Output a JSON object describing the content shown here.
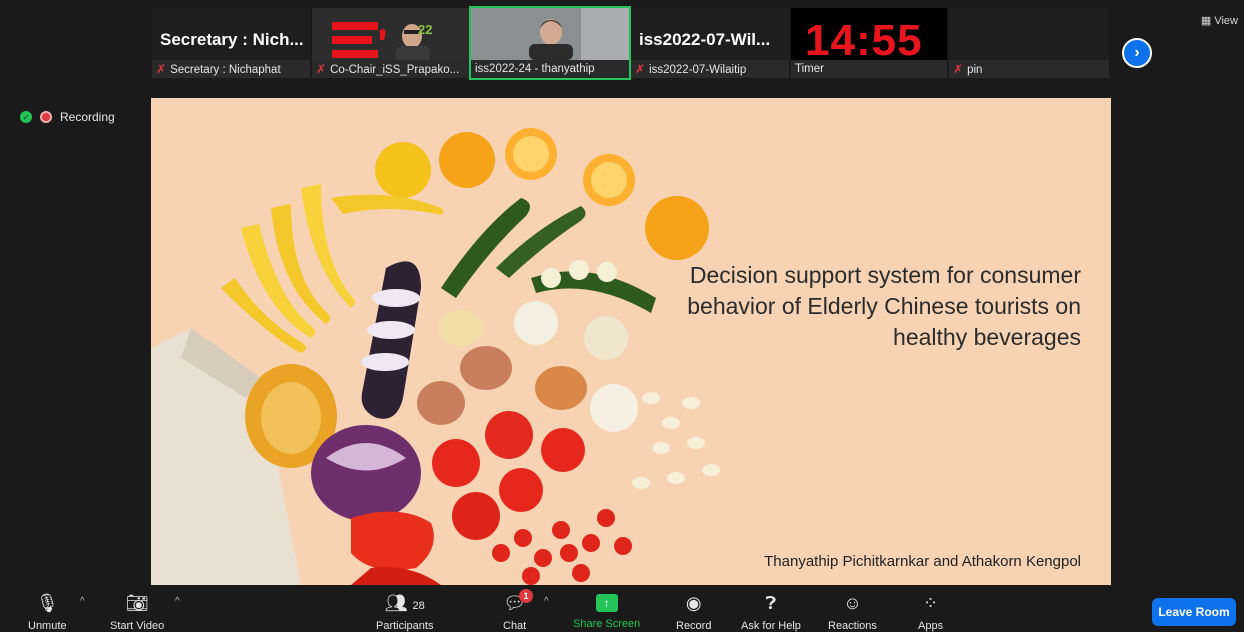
{
  "view_label": "View",
  "tiles": [
    {
      "title": "Secretary : Nich...",
      "name": "Secretary : Nichaphat"
    },
    {
      "title": "",
      "name": "Co-Chair_iSS_Prapako..."
    },
    {
      "title": "",
      "name": "iss2022-24 - thanyathip"
    },
    {
      "title": "iss2022-07-Wil...",
      "name": "iss2022-07-Wilaitip"
    },
    {
      "title": "14:55",
      "name": "Timer"
    },
    {
      "title": "",
      "name": "pin"
    }
  ],
  "logo_text": "22",
  "recording_label": "Recording",
  "slide": {
    "title": "Decision support system for consumer behavior of Elderly Chinese tourists on healthy beverages",
    "authors": "Thanyathip Pichitkarnkar  and  Athakorn Kengpol"
  },
  "toolbar": {
    "unmute": "Unmute",
    "start_video": "Start Video",
    "participants": "Participants",
    "participants_count": "28",
    "chat": "Chat",
    "chat_badge": "1",
    "share_screen": "Share Screen",
    "record": "Record",
    "ask_for_help": "Ask for Help",
    "reactions": "Reactions",
    "apps": "Apps",
    "leave_room": "Leave Room"
  },
  "colors": {
    "accent": "#0e72ed",
    "share_green": "#23c559",
    "timer_red": "#e8161c",
    "muted_red": "#e0383e"
  },
  "icons": [
    "mic-off-icon",
    "video-off-icon",
    "participants-icon",
    "chat-icon",
    "share-screen-icon",
    "record-icon",
    "help-icon",
    "reactions-icon",
    "apps-icon",
    "shield-icon",
    "chevron-right-icon"
  ]
}
